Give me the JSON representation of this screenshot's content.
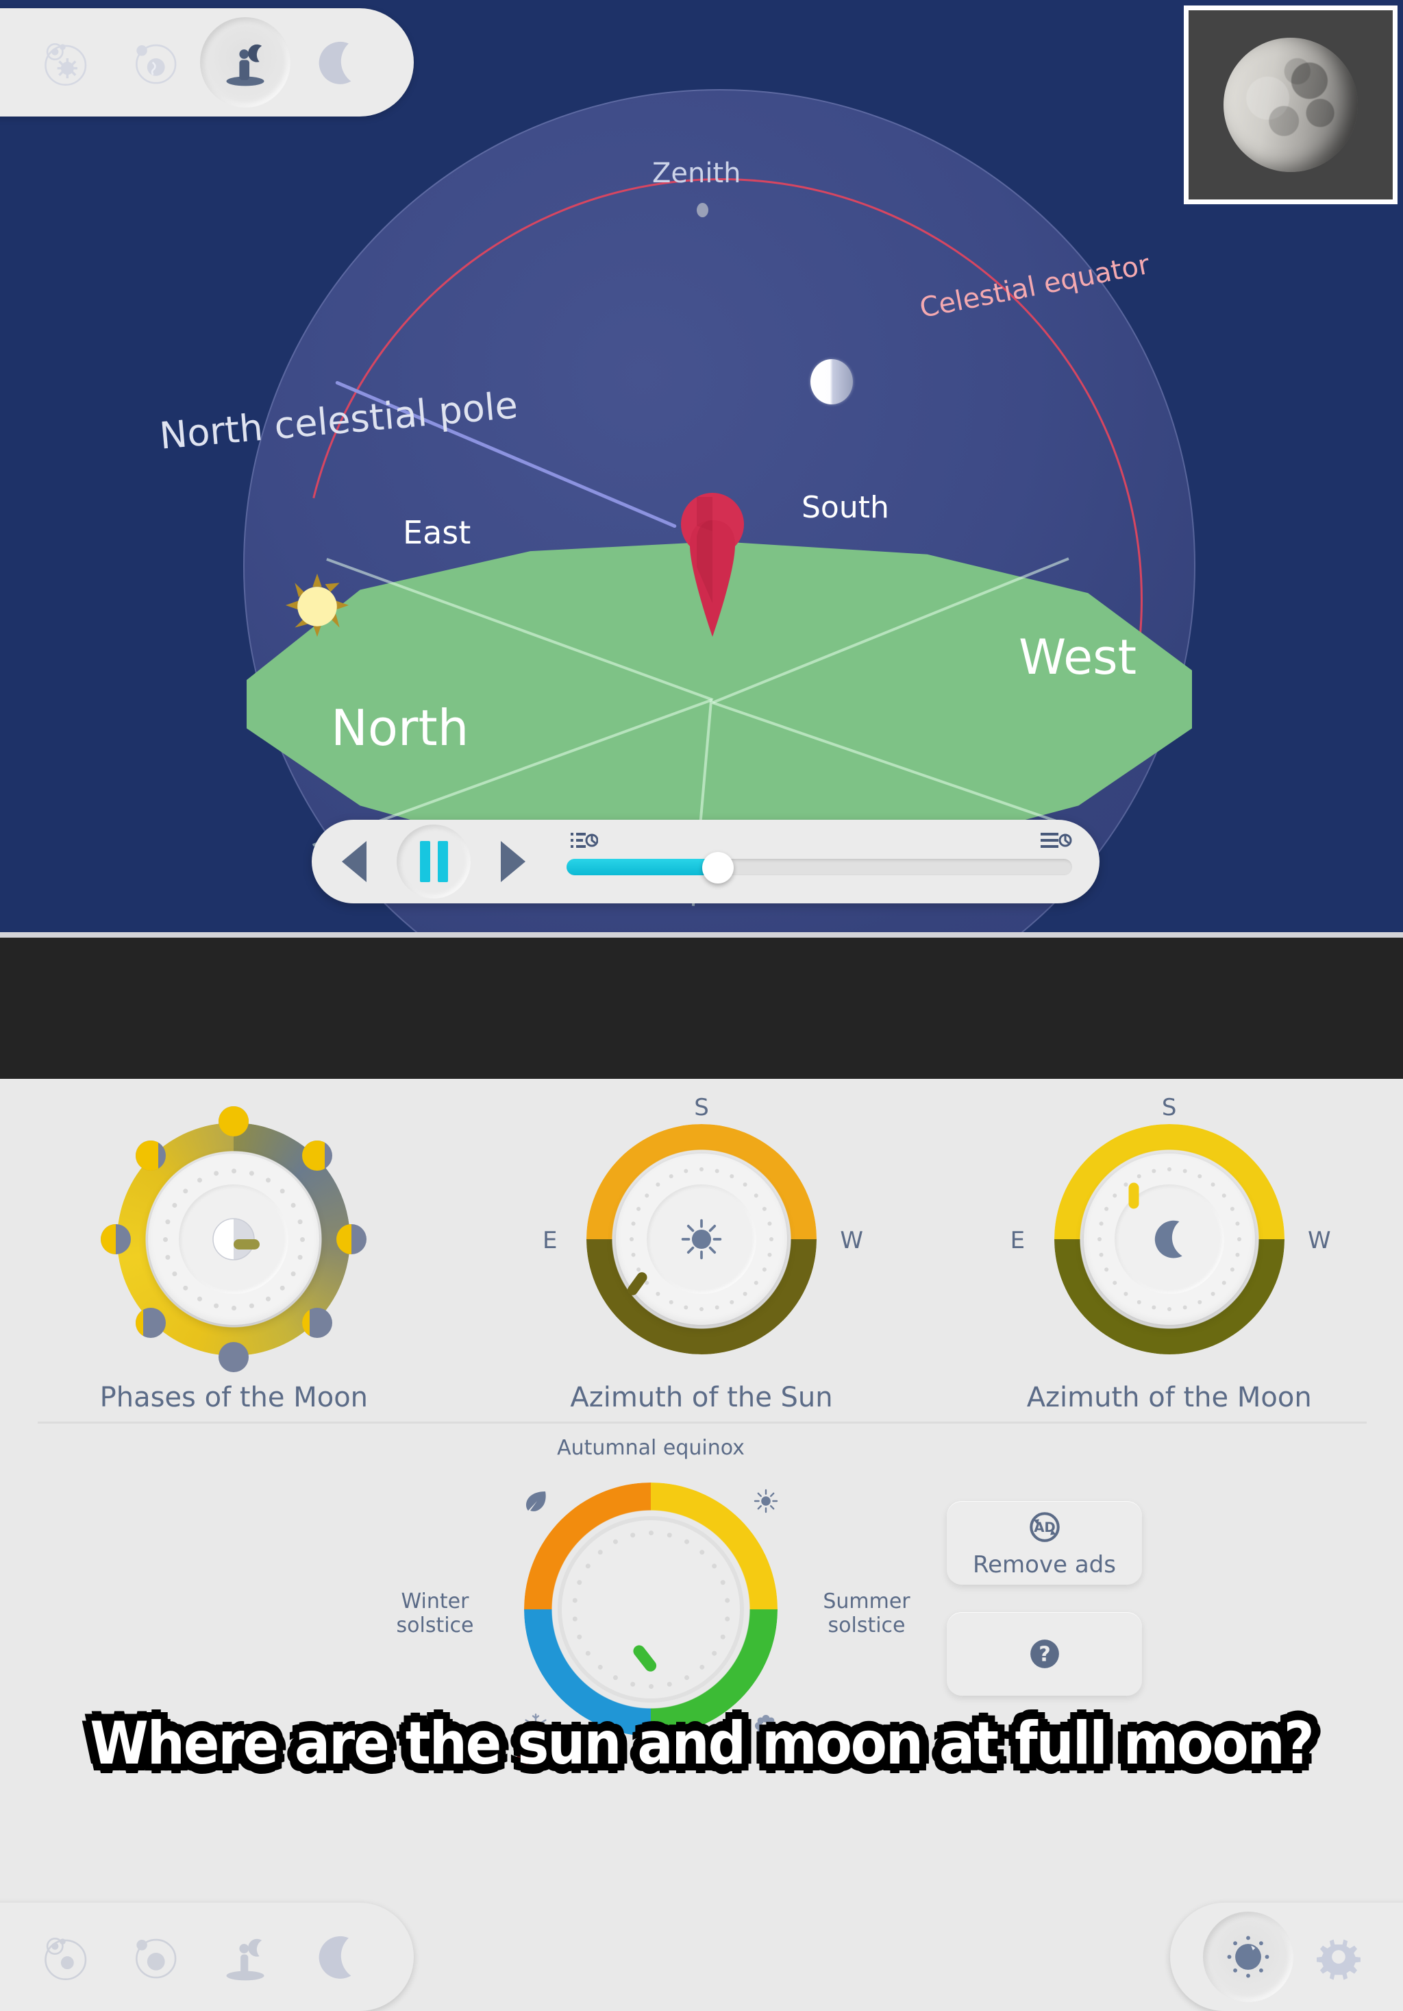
{
  "app": {
    "caption": "Where are the sun and moon at full moon?"
  },
  "toolbar_top": {
    "items": [
      {
        "label": "Sun and planets view",
        "icon": "solar-system-icon",
        "selected": false
      },
      {
        "label": "Earth and Moon view",
        "icon": "earth-moon-orbit-icon",
        "selected": false
      },
      {
        "label": "Observer sky view",
        "icon": "observer-horizon-icon",
        "selected": true
      },
      {
        "label": "Moon phase view",
        "icon": "moon-crescent-icon",
        "selected": false
      }
    ]
  },
  "toolbar_bottom_left": {
    "items": [
      {
        "label": "Sun and planets view",
        "icon": "solar-system-icon",
        "selected": false
      },
      {
        "label": "Earth and Moon view",
        "icon": "earth-moon-orbit-icon",
        "selected": false
      },
      {
        "label": "Observer sky view",
        "icon": "observer-horizon-icon",
        "selected": false
      },
      {
        "label": "Moon phase view",
        "icon": "moon-crescent-icon",
        "selected": false
      }
    ]
  },
  "toolbar_bottom_right": {
    "items": [
      {
        "label": "Dials panel",
        "icon": "dial-knob-icon",
        "selected": true
      },
      {
        "label": "Settings",
        "icon": "gear-icon",
        "selected": false
      }
    ]
  },
  "sky_view": {
    "labels": {
      "zenith": "Zenith",
      "north_celestial_pole": "North celestial pole",
      "celestial_equator": "Celestial equator",
      "east": "East",
      "south": "South",
      "west": "West",
      "north": "North"
    },
    "colors": {
      "sky_background": "#1e3268",
      "dome": "#3d4a86",
      "ground": "#7ec286",
      "celestial_equator": "#e0465f",
      "polar_axis": "#8c93e0",
      "observer_marker": "#cf2a4d",
      "sun": "#fdf2ab"
    },
    "moon_inset": {
      "phase": "waning gibbous",
      "background": "#444444",
      "border": "#ffffff"
    }
  },
  "playback": {
    "rewind_label": "Step backward",
    "pause_label": "Pause",
    "play_label": "Play",
    "speed_slider": {
      "value_percent": 30,
      "min_icon": "slow-speed-icon",
      "max_icon": "fast-speed-icon"
    },
    "colors": {
      "accent": "#17c6e0",
      "bar": "#ebebeb"
    }
  },
  "dials": [
    {
      "title": "Phases of the Moon",
      "center_icon": "half-moon-icon",
      "pointer_angle_deg": 90,
      "ring_colors": [
        "#e8c21c",
        "#8e8c4a",
        "#6b7b8c"
      ],
      "markers": [
        {
          "name": "new-moon",
          "lit_percent": 0,
          "angle_deg": 180
        },
        {
          "name": "waxing-crescent",
          "lit_percent": 25,
          "angle_deg": 225
        },
        {
          "name": "first-quarter",
          "lit_percent": 50,
          "angle_deg": 270
        },
        {
          "name": "waxing-gibbous",
          "lit_percent": 75,
          "angle_deg": 315
        },
        {
          "name": "full-moon",
          "lit_percent": 100,
          "angle_deg": 0
        },
        {
          "name": "waning-gibbous",
          "lit_percent": 75,
          "angle_deg": 45
        },
        {
          "name": "last-quarter",
          "lit_percent": 50,
          "angle_deg": 90
        },
        {
          "name": "waning-crescent",
          "lit_percent": 25,
          "angle_deg": 135
        }
      ]
    },
    {
      "title": "Azimuth of the Sun",
      "center_icon": "sun-icon",
      "pointer_angle_deg": 216,
      "direction_labels": {
        "top": "S",
        "left": "E",
        "right": "W"
      },
      "ring_colors": {
        "day": "#f0a818",
        "night": "#6b6315"
      }
    },
    {
      "title": "Azimuth of the Moon",
      "center_icon": "crescent-moon-icon",
      "pointer_angle_deg": 0,
      "direction_labels": {
        "top": "S",
        "left": "E",
        "right": "W"
      },
      "ring_colors": {
        "day": "#f2cc13",
        "night": "#6a6a11"
      }
    }
  ],
  "season_dial": {
    "labels": {
      "top": "Autumnal equinox",
      "left": "Winter solstice",
      "right": "Summer solstice"
    },
    "icons": [
      "leaf-icon",
      "sun-icon",
      "snowflake-icon",
      "flower-icon"
    ],
    "quadrant_colors": {
      "autumn": "#f28c0e",
      "spring": "#f5cb12",
      "summer": "#3cbb35",
      "winter": "#2096d6"
    },
    "pointer_angle_deg": 52,
    "pointer_color": "#3cbb35"
  },
  "side_buttons": {
    "remove_ads": {
      "label": "Remove ads",
      "icon": "no-ads-icon"
    },
    "help": {
      "label": "",
      "icon": "question-mark-icon"
    }
  }
}
